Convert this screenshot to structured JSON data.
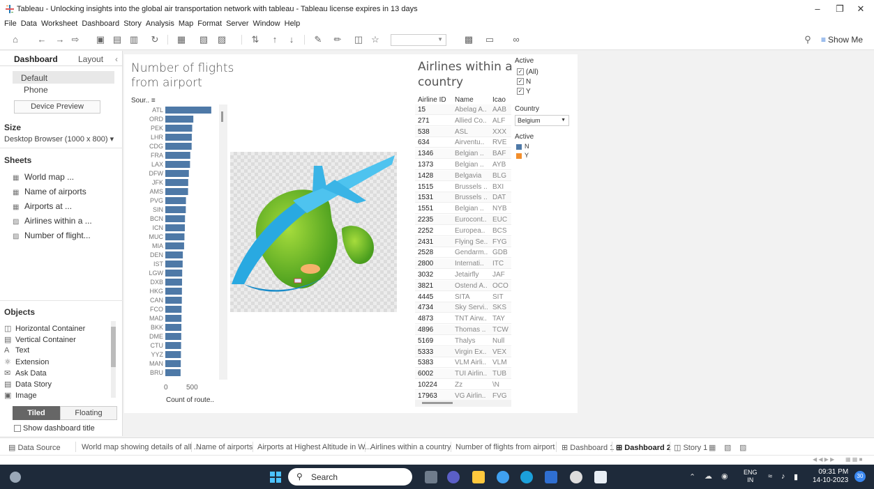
{
  "window": {
    "title": "Tableau - Unlocking insights into the global air transportation network with tableau - Tableau license expires in 13 days"
  },
  "menu": [
    "File",
    "Data",
    "Worksheet",
    "Dashboard",
    "Story",
    "Analysis",
    "Map",
    "Format",
    "Server",
    "Window",
    "Help"
  ],
  "toolbar": {
    "show_me": "Show Me"
  },
  "left_panel": {
    "tab_dashboard": "Dashboard",
    "tab_layout": "Layout",
    "device_default": "Default",
    "device_phone": "Phone",
    "device_preview": "Device Preview",
    "size_title": "Size",
    "size_value": "Desktop Browser (1000 x 800)",
    "sheets_title": "Sheets",
    "sheets": [
      "World map ...",
      "Name of airports",
      "Airports at ...",
      "Airlines within a ...",
      "Number of flight..."
    ],
    "objects_title": "Objects",
    "objects": [
      "Horizontal Container",
      "Vertical Container",
      "Text",
      "Extension",
      "Ask Data",
      "Data Story",
      "Image"
    ],
    "tiled": "Tiled",
    "floating": "Floating",
    "show_title": "Show dashboard title"
  },
  "flights_chart": {
    "title_line1": "Number of flights",
    "title_line2": "from airport",
    "header": "Sour..",
    "axis_tick_0": "0",
    "axis_tick_500": "500",
    "axis_label": "Count of route.."
  },
  "chart_data": {
    "type": "bar",
    "orientation": "horizontal",
    "categories": [
      "ATL",
      "ORD",
      "PEK",
      "LHR",
      "CDG",
      "FRA",
      "LAX",
      "DFW",
      "JFK",
      "AMS",
      "PVG",
      "SIN",
      "BCN",
      "ICN",
      "MUC",
      "MIA",
      "DEN",
      "IST",
      "LGW",
      "DXB",
      "HKG",
      "CAN",
      "FCO",
      "MAD",
      "BKK",
      "DME",
      "CTU",
      "YYZ",
      "MAN",
      "BRU"
    ],
    "values": [
      915,
      558,
      535,
      527,
      524,
      497,
      492,
      469,
      456,
      453,
      411,
      408,
      392,
      389,
      381,
      374,
      349,
      345,
      336,
      333,
      331,
      329,
      324,
      322,
      320,
      317,
      314,
      311,
      308,
      304
    ],
    "xlabel": "Count of route..",
    "ylabel": "Sour..",
    "xlim": [
      0,
      1000
    ],
    "color": "#4e79a7"
  },
  "airlines_table": {
    "title_line1": "Airlines within a",
    "title_line2": "country",
    "columns": [
      "Airline ID",
      "Name",
      "Icao"
    ],
    "rows": [
      [
        "15",
        "Abelag A..",
        "AAB"
      ],
      [
        "271",
        "Allied Co..",
        "ALF"
      ],
      [
        "538",
        "ASL",
        "XXX"
      ],
      [
        "634",
        "Airventu..",
        "RVE"
      ],
      [
        "1346",
        "Belgian ..",
        "BAF"
      ],
      [
        "1373",
        "Belgian ..",
        "AYB"
      ],
      [
        "1428",
        "Belgavia",
        "BLG"
      ],
      [
        "1515",
        "Brussels ..",
        "BXI"
      ],
      [
        "1531",
        "Brussels ..",
        "DAT"
      ],
      [
        "1551",
        "Belgian ..",
        "NYB"
      ],
      [
        "2235",
        "Eurocont..",
        "EUC"
      ],
      [
        "2252",
        "Europea..",
        "BCS"
      ],
      [
        "2431",
        "Flying Se..",
        "FYG"
      ],
      [
        "2528",
        "Gendarm..",
        "GDB"
      ],
      [
        "2800",
        "Internati..",
        "ITC"
      ],
      [
        "3032",
        "Jetairfly",
        "JAF"
      ],
      [
        "3821",
        "Ostend A..",
        "OCO"
      ],
      [
        "4445",
        "SITA",
        "SIT"
      ],
      [
        "4734",
        "Sky Servi..",
        "SKS"
      ],
      [
        "4873",
        "TNT Airw..",
        "TAY"
      ],
      [
        "4896",
        "Thomas ..",
        "TCW"
      ],
      [
        "5169",
        "Thalys",
        "Null"
      ],
      [
        "5333",
        "Virgin Ex..",
        "VEX"
      ],
      [
        "5383",
        "VLM Airli..",
        "VLM"
      ],
      [
        "6002",
        "TUI Airlin..",
        "TUB"
      ],
      [
        "10224",
        "Zz",
        "\\N"
      ],
      [
        "17963",
        "VG Airlin..",
        "FVG"
      ]
    ]
  },
  "filters": {
    "active_title": "Active",
    "active_options": [
      "(All)",
      "N",
      "Y"
    ],
    "country_title": "Country",
    "country_value": "Belgium",
    "legend_title": "Active",
    "legend": [
      {
        "label": "N",
        "color": "#4e79a7"
      },
      {
        "label": "Y",
        "color": "#f28e2b"
      }
    ]
  },
  "bottom_tabs": {
    "data_source": "Data Source",
    "t1": "World map showing details of all ...",
    "t2": "Name of airports",
    "t3": "Airports at Highest Altitude in W...",
    "t4": "Airlines within a country",
    "t5": "Number of flights from airport",
    "t6": "Dashboard 1",
    "t7": "Dashboard 2",
    "t8": "Story 1"
  },
  "taskbar": {
    "search": "Search",
    "lang1": "ENG",
    "lang2": "IN",
    "time": "09:31 PM",
    "date": "14-10-2023",
    "badge": "30"
  }
}
